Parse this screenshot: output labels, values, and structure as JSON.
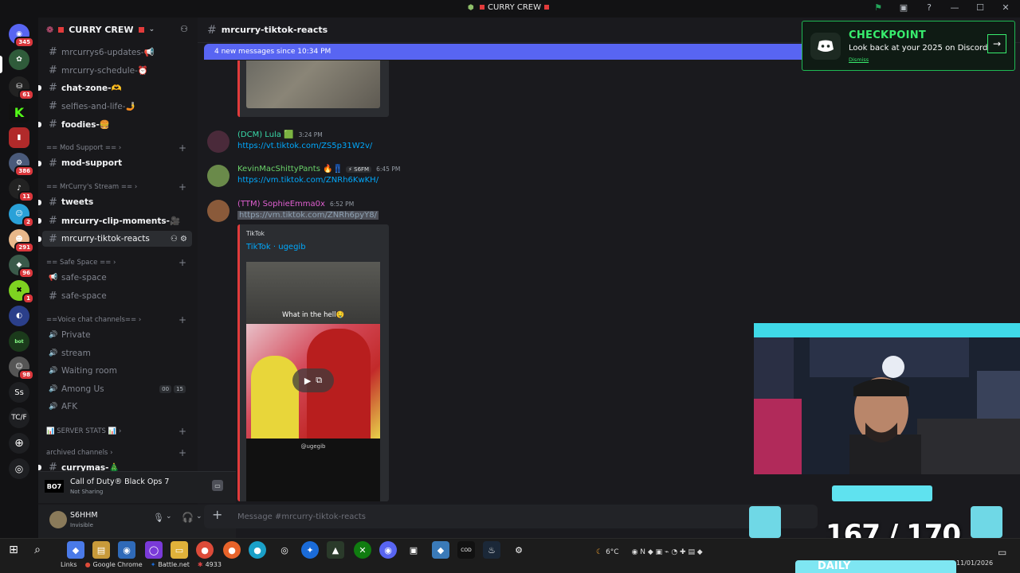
{
  "window": {
    "title": "CURRY CREW"
  },
  "server": {
    "name": "CURRY CREW"
  },
  "rail": {
    "badges": [
      "345",
      "61",
      "386",
      "11",
      "2",
      "291",
      "96",
      "1",
      "98"
    ],
    "text_servers": [
      "Ss",
      "TC/F"
    ]
  },
  "channels": [
    {
      "name": "mrcurrys6-updates-📢"
    },
    {
      "name": "mrcurry-schedule-⏰"
    },
    {
      "name": "chat-zone-🫶"
    },
    {
      "name": "selfies-and-life-🤳"
    },
    {
      "name": "foodies-🍔"
    },
    {
      "name": "mod-support"
    },
    {
      "name": "tweets"
    },
    {
      "name": "mrcurry-clip-moments-🎥"
    },
    {
      "name": "mrcurry-tiktok-reacts"
    },
    {
      "name": "safe-space"
    },
    {
      "name": "safe-space"
    },
    {
      "name": "Private"
    },
    {
      "name": "stream"
    },
    {
      "name": "Waiting room"
    },
    {
      "name": "Among Us"
    },
    {
      "name": "AFK"
    },
    {
      "name": "currymas-🎄"
    }
  ],
  "categories": [
    "== Mod Support ==",
    "== MrCurry's Stream ==",
    "== Safe Space ==",
    "==Voice chat channels==",
    "📊 SERVER STATS 📊",
    "archived channels"
  ],
  "among_us_counts": [
    "00",
    "15"
  ],
  "activity": {
    "game": "Call of Duty® Black Ops 7",
    "status": "Not Sharing"
  },
  "user": {
    "name": "S6HHM",
    "status": "Invisible"
  },
  "current_channel": "mrcurry-tiktok-reacts",
  "new_messages": "4 new messages since 10:34 PM",
  "messages": [
    {
      "author": "(DCM) Lula 🟩",
      "time": "3:24 PM",
      "link": "https://vt.tiktok.com/ZS5p31W2v/",
      "color": "#38d9a9"
    },
    {
      "author": "KevinMacShittyPants 🔥👖",
      "tag": "⚡ S6FM",
      "time": "6:45 PM",
      "link": "https://vm.tiktok.com/ZNRh6KwKH/",
      "color": "#6ad36a"
    },
    {
      "author": "(TTM) SophieEmma0x",
      "time": "6:52 PM",
      "link": "https://vm.tiktok.com/ZNRh6pyY8/",
      "color": "#e05fd0"
    }
  ],
  "embed": {
    "provider": "TikTok",
    "title": "TikTok · ugegib",
    "caption": "What in the hell🤤",
    "handle": "@ugegib"
  },
  "composer_placeholder": "Message #mrcurry-tiktok-reacts",
  "promo": {
    "title": "CHECKPOINT",
    "subtitle": "Look back at your 2025 on Discord",
    "dismiss": "Dismiss"
  },
  "overlay": {
    "counter": "167 / 170",
    "daily": "DAILY"
  },
  "taskbar": {
    "links": [
      "Links",
      "Google Chrome",
      "Battle.net",
      "4933"
    ],
    "weather": "6°C",
    "date": "11/01/2026"
  },
  "colors": {
    "accent": "#5865f2",
    "promo_green": "#38ed6e",
    "link": "#00a8fc",
    "server_red": "#e23b3b"
  }
}
